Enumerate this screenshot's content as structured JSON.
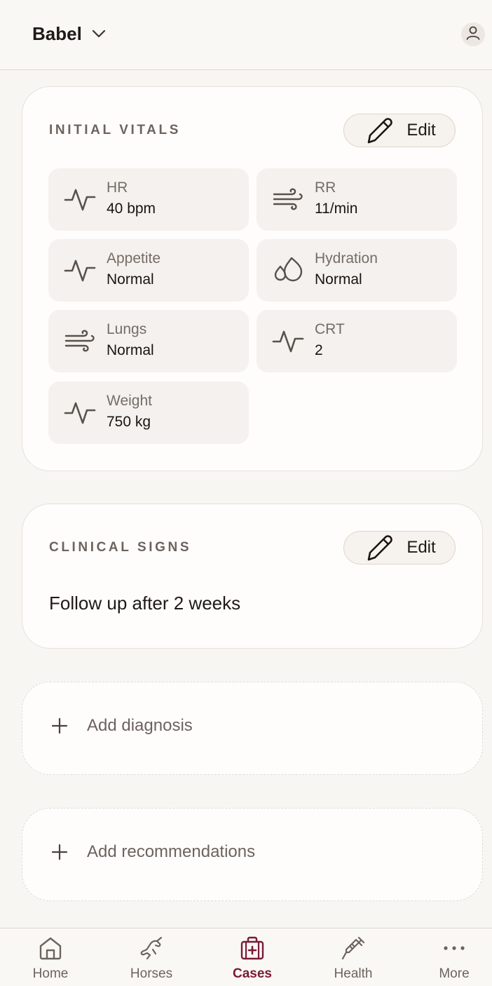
{
  "header": {
    "horse_name": "Babel",
    "icons": {
      "selector": "chevron-down-icon",
      "profile": "user-icon"
    }
  },
  "vitals": {
    "title": "INITIAL VITALS",
    "edit_label": "Edit",
    "items": [
      {
        "label": "HR",
        "value": "40 bpm",
        "icon": "pulse-icon"
      },
      {
        "label": "RR",
        "value": "11/min",
        "icon": "wind-icon"
      },
      {
        "label": "Appetite",
        "value": "Normal",
        "icon": "pulse-icon"
      },
      {
        "label": "Hydration",
        "value": "Normal",
        "icon": "droplets-icon"
      },
      {
        "label": "Lungs",
        "value": "Normal",
        "icon": "wind-icon"
      },
      {
        "label": "CRT",
        "value": "2",
        "icon": "pulse-icon"
      },
      {
        "label": "Weight",
        "value": "750 kg",
        "icon": "pulse-icon"
      }
    ]
  },
  "clinical_signs": {
    "title": "CLINICAL SIGNS",
    "edit_label": "Edit",
    "text": "Follow up after 2 weeks"
  },
  "add_diagnosis": {
    "label": "Add diagnosis"
  },
  "add_recommendations": {
    "label": "Add recommendations"
  },
  "nav": {
    "active": "Cases",
    "items": [
      {
        "label": "Home",
        "icon": "home-icon"
      },
      {
        "label": "Horses",
        "icon": "horse-icon"
      },
      {
        "label": "Cases",
        "icon": "medical-kit-icon"
      },
      {
        "label": "Health",
        "icon": "syringe-icon"
      },
      {
        "label": "More",
        "icon": "more-dots-icon"
      }
    ]
  },
  "colors": {
    "background": "#f8f6f3",
    "card": "#fefdfc",
    "tile": "#f4f1ee",
    "muted_text": "#6d635d",
    "accent": "#7a1a36"
  }
}
